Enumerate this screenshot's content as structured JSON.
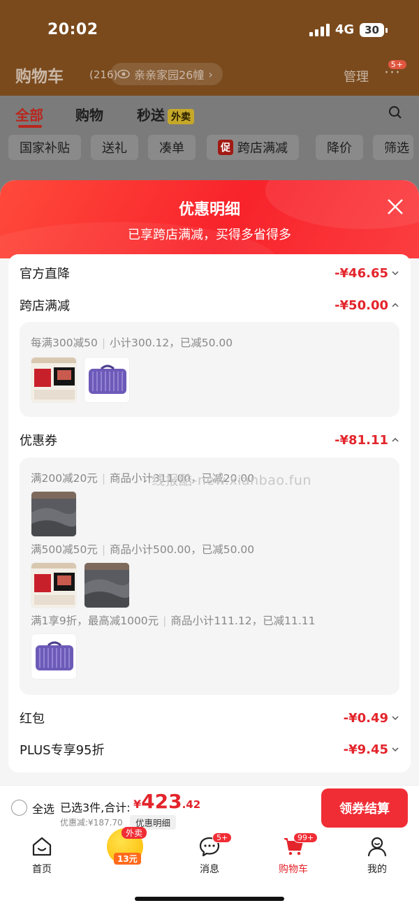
{
  "status_bar": {
    "time": "20:02",
    "network": "4G",
    "battery": "30"
  },
  "header": {
    "title": "购物车",
    "count": "(216)",
    "address": "亲亲家园26幢",
    "manage": "管理",
    "more_badge": "5+"
  },
  "tabs": [
    {
      "label": "全部"
    },
    {
      "label": "购物"
    },
    {
      "label": "秒送",
      "tag": "外卖"
    }
  ],
  "filters": [
    {
      "label": "国家补贴"
    },
    {
      "label": "送礼"
    },
    {
      "label": "凑单"
    },
    {
      "label": "跨店满减",
      "tag": "促"
    },
    {
      "label": "降价"
    },
    {
      "label": "筛选"
    }
  ],
  "modal": {
    "title": "优惠明细",
    "subtitle": "已享跨店满减，买得多省得多",
    "rows": {
      "official": {
        "label": "官方直降",
        "amount": "-¥46.65"
      },
      "crossstore": {
        "label": "跨店满减",
        "amount": "-¥50.00"
      },
      "coupon": {
        "label": "优惠券",
        "amount": "-¥81.11"
      },
      "redpacket": {
        "label": "红包",
        "amount": "-¥0.49"
      },
      "plus": {
        "label": "PLUS专享95折",
        "amount": "-¥9.45"
      }
    },
    "crossstore_detail": {
      "text_a": "每满300减50",
      "text_b": "小计300.12，已减50.00"
    },
    "coupon_details": [
      {
        "text_a": "满200减20元",
        "text_b": "商品小计311.00，已减20.00"
      },
      {
        "text_a": "满500减50元",
        "text_b": "商品小计500.00，已减50.00"
      },
      {
        "text_a": "满1享9折，最高减1000元",
        "text_b": "商品小计111.12，已减11.11"
      }
    ],
    "watermark": "线报酷-new.xianbao.fun"
  },
  "checkout": {
    "select_all": "全选",
    "selected": "已选3件,合计:",
    "currency": "¥",
    "total_int": "423",
    "total_dec": ".42",
    "discount": "优惠减:¥187.70",
    "detail_link": "优惠明细",
    "button": "领券结算"
  },
  "nav": {
    "home": "首页",
    "waimai_tag": "外卖",
    "waimai_amount": "13元",
    "messages": "消息",
    "messages_badge": "5+",
    "cart": "购物车",
    "cart_badge": "99+",
    "me": "我的"
  },
  "colors": {
    "accent_red": "#e3242b",
    "header_brown": "#7a4a1d",
    "button_red": "#f02d35"
  }
}
